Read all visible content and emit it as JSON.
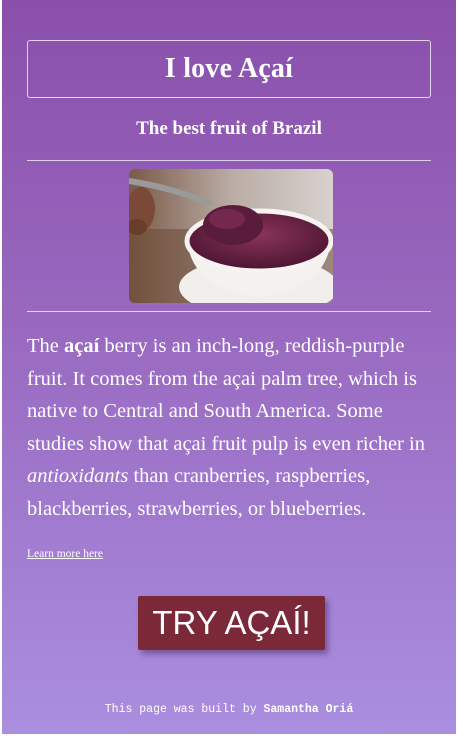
{
  "header": {
    "title": "I love Açaí",
    "subtitle": "The best fruit of Brazil"
  },
  "image": {
    "alt": "Açaí bowl with spoon"
  },
  "description": {
    "part1": "The ",
    "bold": "açaí",
    "part2": " berry is an inch-long, reddish-purple fruit. It comes from the açai palm tree, which is native to Central and South America. Some studies show that açai fruit pulp is even richer in ",
    "italic": "antioxidants",
    "part3": " than cranberries, raspberries, blackberries, strawberries, or blueberries."
  },
  "link": {
    "label": "Learn more here"
  },
  "cta": {
    "label": "TRY AÇAÍ!",
    "color": "#7b2838"
  },
  "footer": {
    "prefix": "This page was built by ",
    "author": "Samantha Oriá"
  },
  "colors": {
    "gradient_top": "#8a4fab",
    "gradient_bottom": "#aa8ee0"
  }
}
